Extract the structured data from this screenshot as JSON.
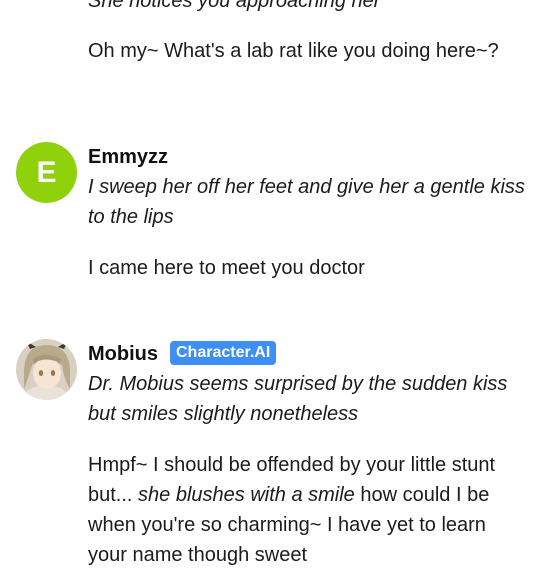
{
  "messages": [
    {
      "action_top": "She notices you approaching her",
      "text": "Oh my~ What's a lab rat like you doing here~?"
    },
    {
      "author": "Emmyzz",
      "avatar_letter": "E",
      "action": "I sweep her off her feet and give her a gentle kiss to the lips",
      "text": "I came here to meet you doctor"
    },
    {
      "author": "Mobius",
      "badge": "Character.AI",
      "action": "Dr. Mobius seems surprised by the sudden kiss but smiles slightly nonetheless",
      "text_part1": "Hmpf~ I should be offended by your little stunt but... ",
      "text_action": "she blushes with a smile",
      "text_part2": " how could I be when you're so charming~ I have yet to learn your name though sweet"
    }
  ],
  "colors": {
    "user_avatar": "#8fd10b",
    "badge": "#3d8ef5"
  }
}
